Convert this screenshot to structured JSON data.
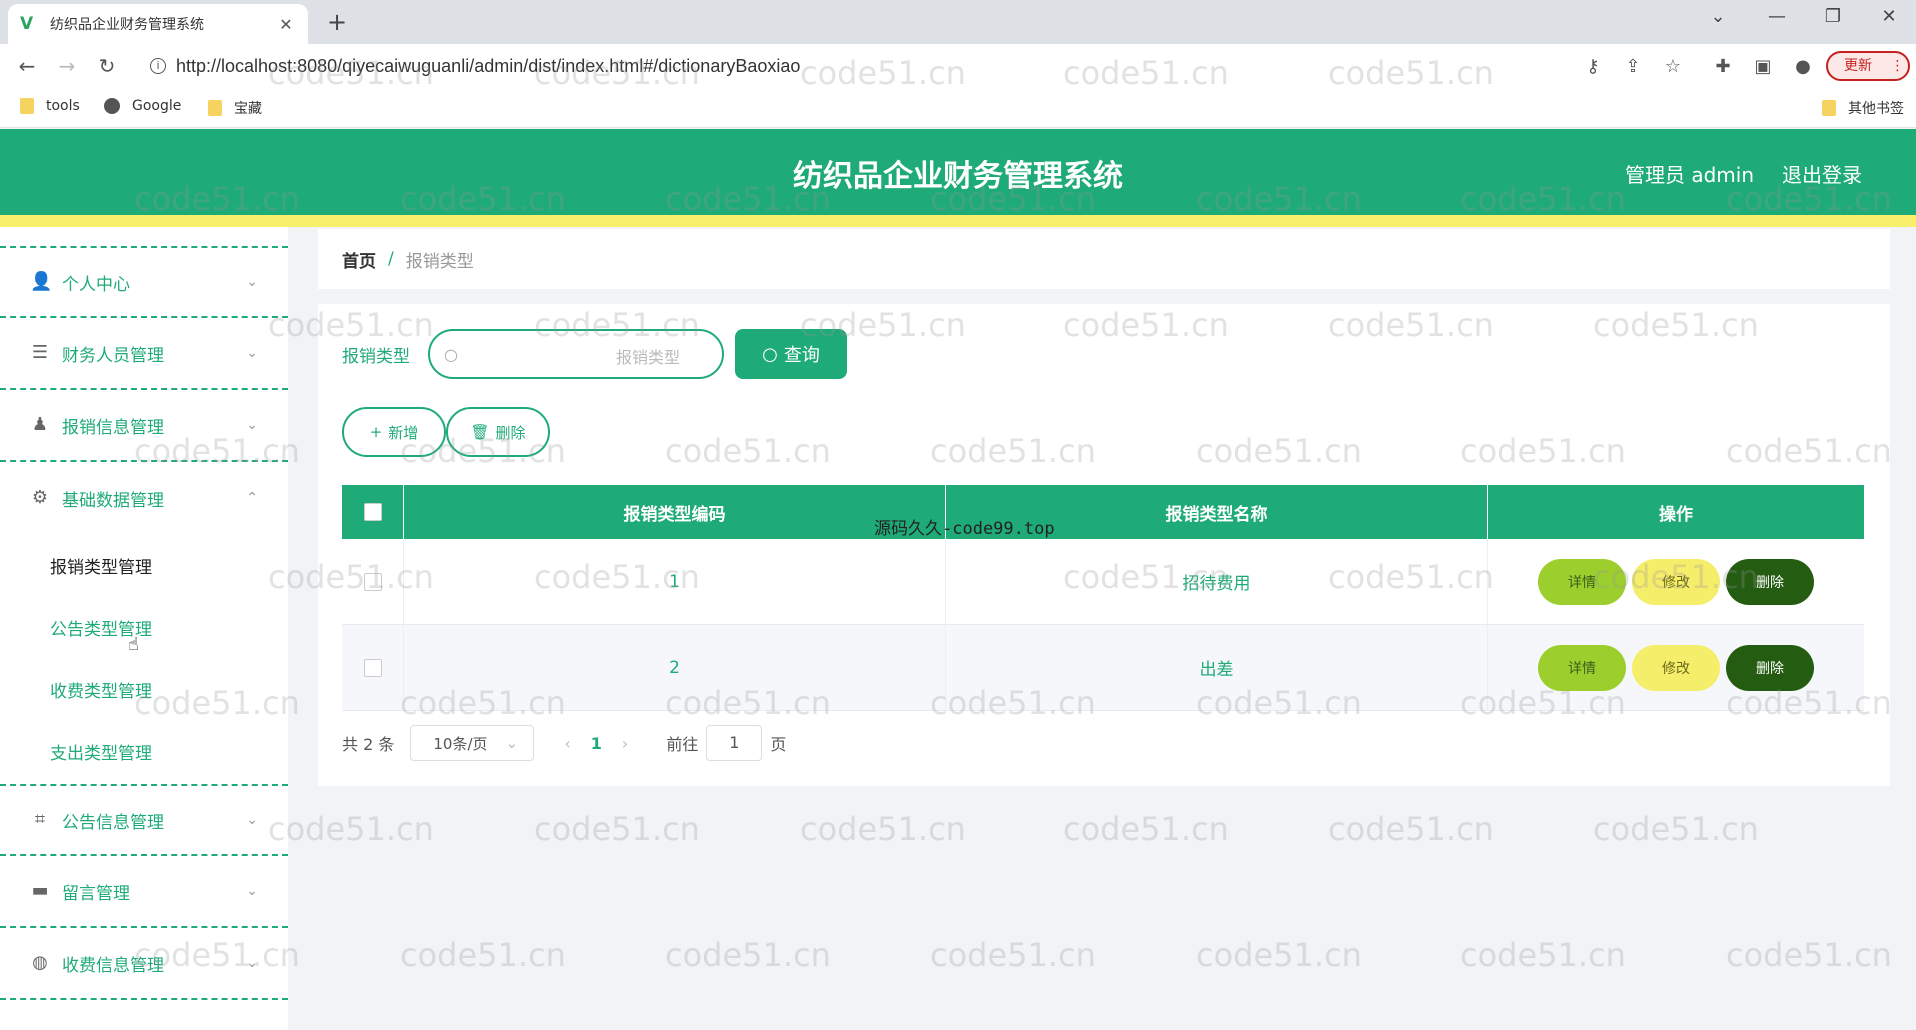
{
  "browser": {
    "tab_title": "纺织品企业财务管理系统",
    "url": "http://localhost:8080/qiyecaiwuguanli/admin/dist/index.html#/dictionaryBaoxiao",
    "update_label": "更新",
    "bookmarks": [
      "tools",
      "Google",
      "宝藏"
    ],
    "other_bookmarks": "其他书签"
  },
  "header": {
    "title": "纺织品企业财务管理系统",
    "admin": "管理员 admin",
    "logout": "退出登录"
  },
  "sidebar": {
    "items": [
      {
        "label": "个人中心",
        "icon": "user-icon"
      },
      {
        "label": "财务人员管理",
        "icon": "sliders-icon"
      },
      {
        "label": "报销信息管理",
        "icon": "person-icon"
      },
      {
        "label": "基础数据管理",
        "icon": "gear-icon"
      },
      {
        "label": "公告信息管理",
        "icon": "crop-icon"
      },
      {
        "label": "留言管理",
        "icon": "briefcase-icon"
      },
      {
        "label": "收费信息管理",
        "icon": "globe-icon"
      }
    ],
    "subitems": [
      "报销类型管理",
      "公告类型管理",
      "收费类型管理",
      "支出类型管理"
    ]
  },
  "breadcrumb": {
    "home": "首页",
    "separator": "/",
    "current": "报销类型"
  },
  "search": {
    "label": "报销类型",
    "placeholder": "报销类型",
    "button": "查询"
  },
  "actions": {
    "add": "新增",
    "delete": "删除"
  },
  "table": {
    "headers": [
      "报销类型编码",
      "报销类型名称",
      "操作"
    ],
    "rows": [
      {
        "code": "1",
        "name": "招待费用"
      },
      {
        "code": "2",
        "name": "出差"
      }
    ],
    "row_actions": {
      "detail": "详情",
      "edit": "修改",
      "delete": "删除"
    }
  },
  "pagination": {
    "total": "共 2 条",
    "page_size": "10条/页",
    "current_page": "1",
    "goto_prefix": "前往",
    "goto_value": "1",
    "goto_suffix": "页"
  },
  "source_note": "源码久久-code99.top",
  "watermark": "code51.cn",
  "colors": {
    "primary": "#1fab77",
    "stripe": "#f8f06a",
    "detail": "#9cce2d",
    "edit": "#f5ee6a",
    "delete": "#245c12"
  }
}
